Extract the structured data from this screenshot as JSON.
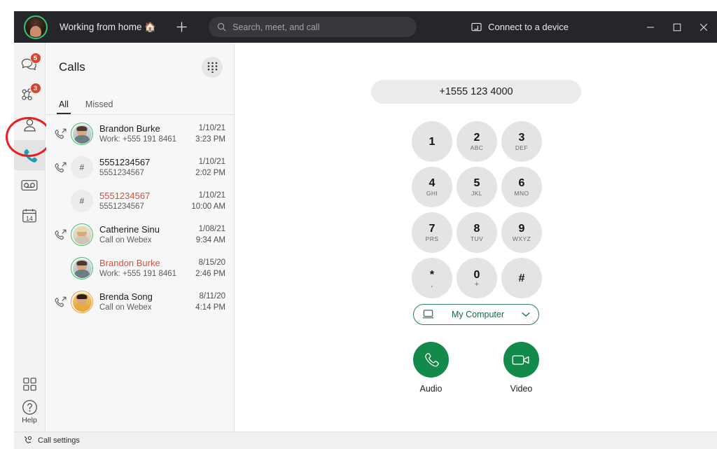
{
  "titlebar": {
    "avatar_name": "user-avatar",
    "status": "Working from home 🏠",
    "add_label": "+",
    "search": {
      "placeholder": "Search, meet, and call",
      "value": ""
    },
    "connect_device": "Connect to a device",
    "window_controls": {
      "minimize": "minimize",
      "maximize": "maximize",
      "close": "close"
    }
  },
  "rail": {
    "items": [
      {
        "name": "messaging",
        "badge": "5"
      },
      {
        "name": "teams",
        "badge": "3"
      },
      {
        "name": "contacts",
        "badge": ""
      },
      {
        "name": "calling",
        "badge": "",
        "selected": true
      },
      {
        "name": "voicemail",
        "badge": ""
      },
      {
        "name": "calendar",
        "badge": "",
        "day": "14"
      }
    ],
    "apps_label": "apps",
    "help_label": "Help"
  },
  "calls_panel": {
    "title": "Calls",
    "dialpad_button": "dialpad-icon",
    "tabs": [
      {
        "label": "All",
        "active": true
      },
      {
        "label": "Missed",
        "active": false
      }
    ],
    "rows": [
      {
        "name": "Brandon Burke",
        "sub": "Work: +555 191 8461",
        "date": "1/10/21",
        "time": "3:23 PM",
        "missed": false,
        "outgoing": true,
        "avatar": "photo-m1",
        "ring": "green"
      },
      {
        "name": "5551234567",
        "sub": "5551234567",
        "date": "1/10/21",
        "time": "2:02 PM",
        "missed": false,
        "outgoing": true,
        "avatar": "hash",
        "ring": "none"
      },
      {
        "name": "5551234567",
        "sub": "5551234567",
        "date": "1/10/21",
        "time": "10:00 AM",
        "missed": true,
        "outgoing": false,
        "avatar": "hash",
        "ring": "none"
      },
      {
        "name": "Catherine Sinu",
        "sub": "Call on Webex",
        "date": "1/08/21",
        "time": "9:34 AM",
        "missed": false,
        "outgoing": true,
        "avatar": "photo-f1",
        "ring": "green"
      },
      {
        "name": "Brandon Burke",
        "sub": "Work: +555 191 8461",
        "date": "8/15/20",
        "time": "2:46 PM",
        "missed": true,
        "outgoing": false,
        "avatar": "photo-m1",
        "ring": "green"
      },
      {
        "name": "Brenda Song",
        "sub": "Call on Webex",
        "date": "8/11/20",
        "time": "4:14 PM",
        "missed": false,
        "outgoing": true,
        "avatar": "photo-f2",
        "ring": "orange"
      }
    ]
  },
  "dialer": {
    "number": "+1555 123 4000",
    "keys": [
      {
        "digit": "1",
        "letters": ""
      },
      {
        "digit": "2",
        "letters": "ABC"
      },
      {
        "digit": "3",
        "letters": "DEF"
      },
      {
        "digit": "4",
        "letters": "GHI"
      },
      {
        "digit": "5",
        "letters": "JKL"
      },
      {
        "digit": "6",
        "letters": "MNO"
      },
      {
        "digit": "7",
        "letters": "PRS"
      },
      {
        "digit": "8",
        "letters": "TUV"
      },
      {
        "digit": "9",
        "letters": "WXYZ"
      },
      {
        "digit": "*",
        "letters": ","
      },
      {
        "digit": "0",
        "letters": "+"
      },
      {
        "digit": "#",
        "letters": ""
      }
    ],
    "device": {
      "label": "My Computer",
      "icon": "laptop-icon",
      "chevron": "chevron-down-icon"
    },
    "audio_label": "Audio",
    "video_label": "Video"
  },
  "statusbar": {
    "label": "Call settings"
  },
  "colors": {
    "titlebar_bg": "#25262a",
    "accent_teal": "#1e9bb5",
    "call_green": "#118a4a",
    "badge_red": "#d8422e",
    "missed_red": "#d3503c",
    "annotation_red": "#ee1c1c",
    "presence_available": "#3ec06d",
    "presence_away": "#f2a13c"
  }
}
